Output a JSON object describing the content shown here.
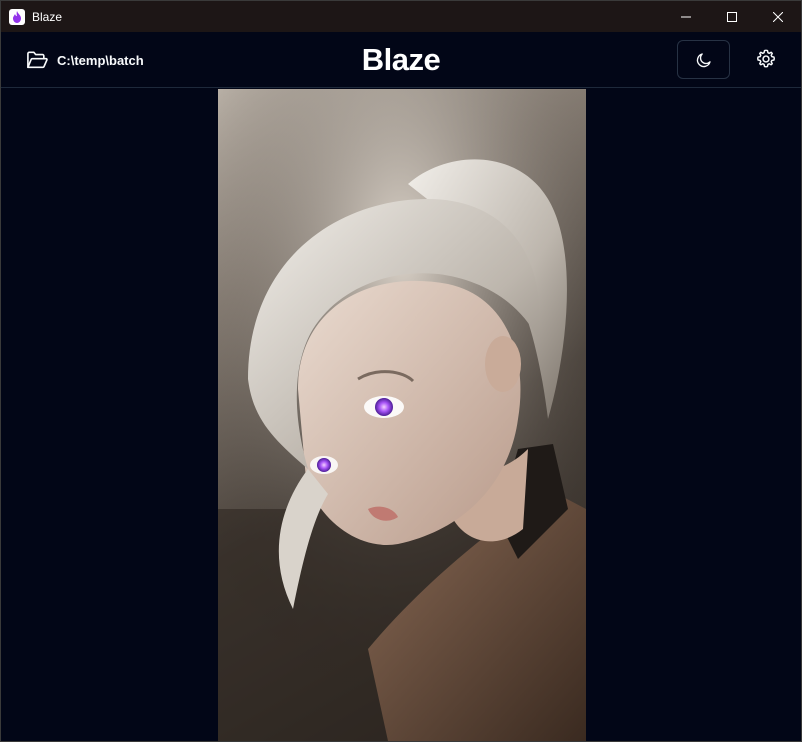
{
  "window": {
    "title": "Blaze",
    "controls": [
      "minimize-icon",
      "maximize-icon",
      "close-icon"
    ]
  },
  "header": {
    "folder_icon": "folder-open-icon",
    "folder_path": "C:\\temp\\batch",
    "brand": "Blaze",
    "theme_icon": "moon-icon",
    "settings_icon": "gear-icon"
  },
  "viewer": {
    "image_subject": "portrait-illustration"
  },
  "colors": {
    "background": "#020617",
    "titlebar": "#1d1616",
    "border": "#1e293b",
    "text": "#f8fafc",
    "eye_glow": "#a855f7"
  }
}
